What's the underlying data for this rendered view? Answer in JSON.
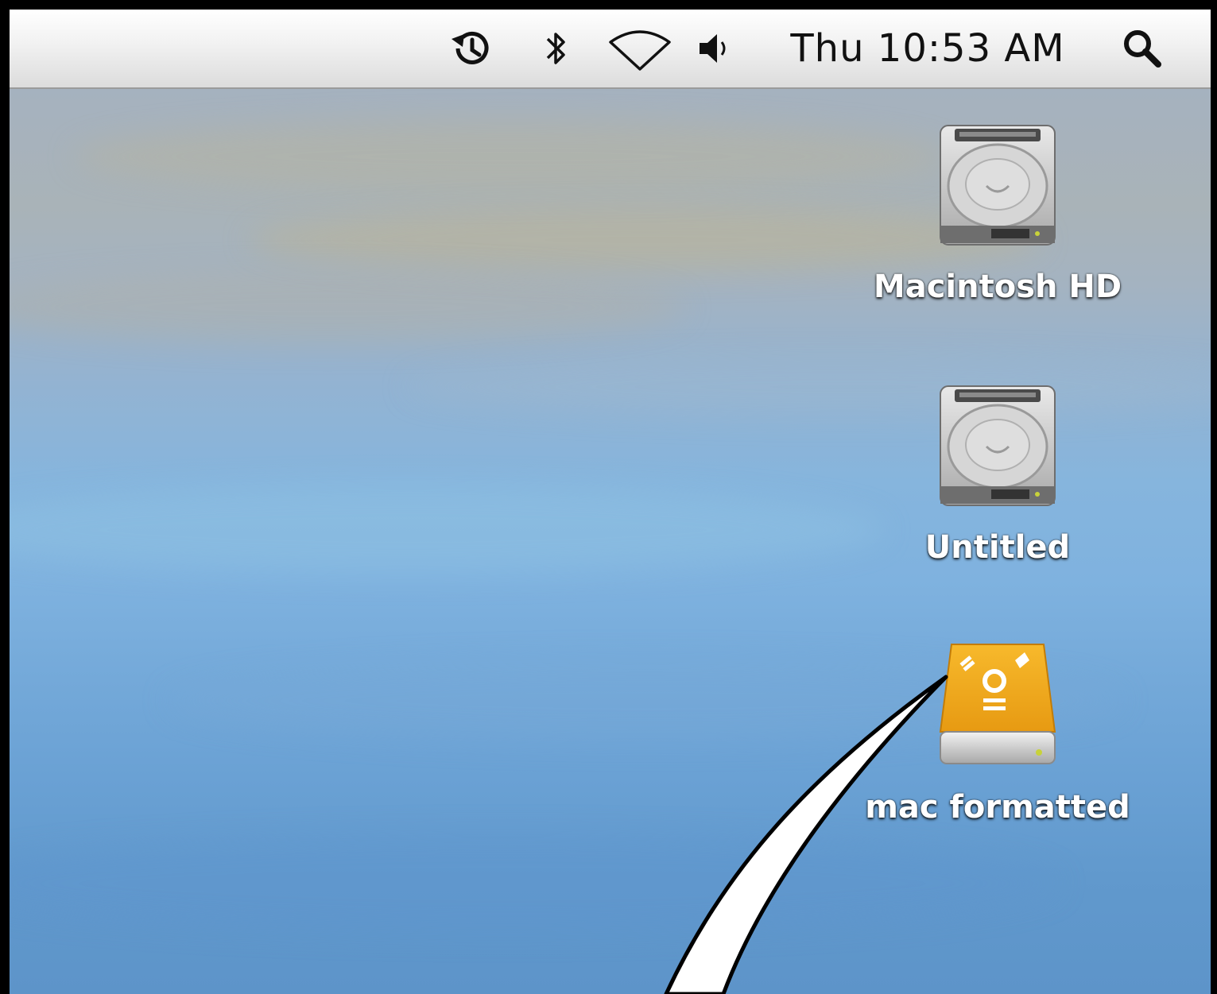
{
  "menubar": {
    "icons": [
      "time-machine-icon",
      "bluetooth-icon",
      "wifi-icon",
      "volume-icon",
      "spotlight-search-icon"
    ],
    "clock": "Thu 10:53 AM"
  },
  "desktop": {
    "items": [
      {
        "label": "Macintosh HD",
        "icon": "hard-drive-icon"
      },
      {
        "label": "Untitled",
        "icon": "hard-drive-icon"
      },
      {
        "label": "mac formatted",
        "icon": "firewire-drive-icon"
      }
    ]
  },
  "colors": {
    "firewire_drive": "#f0a81e",
    "menubar": "#efefef"
  }
}
